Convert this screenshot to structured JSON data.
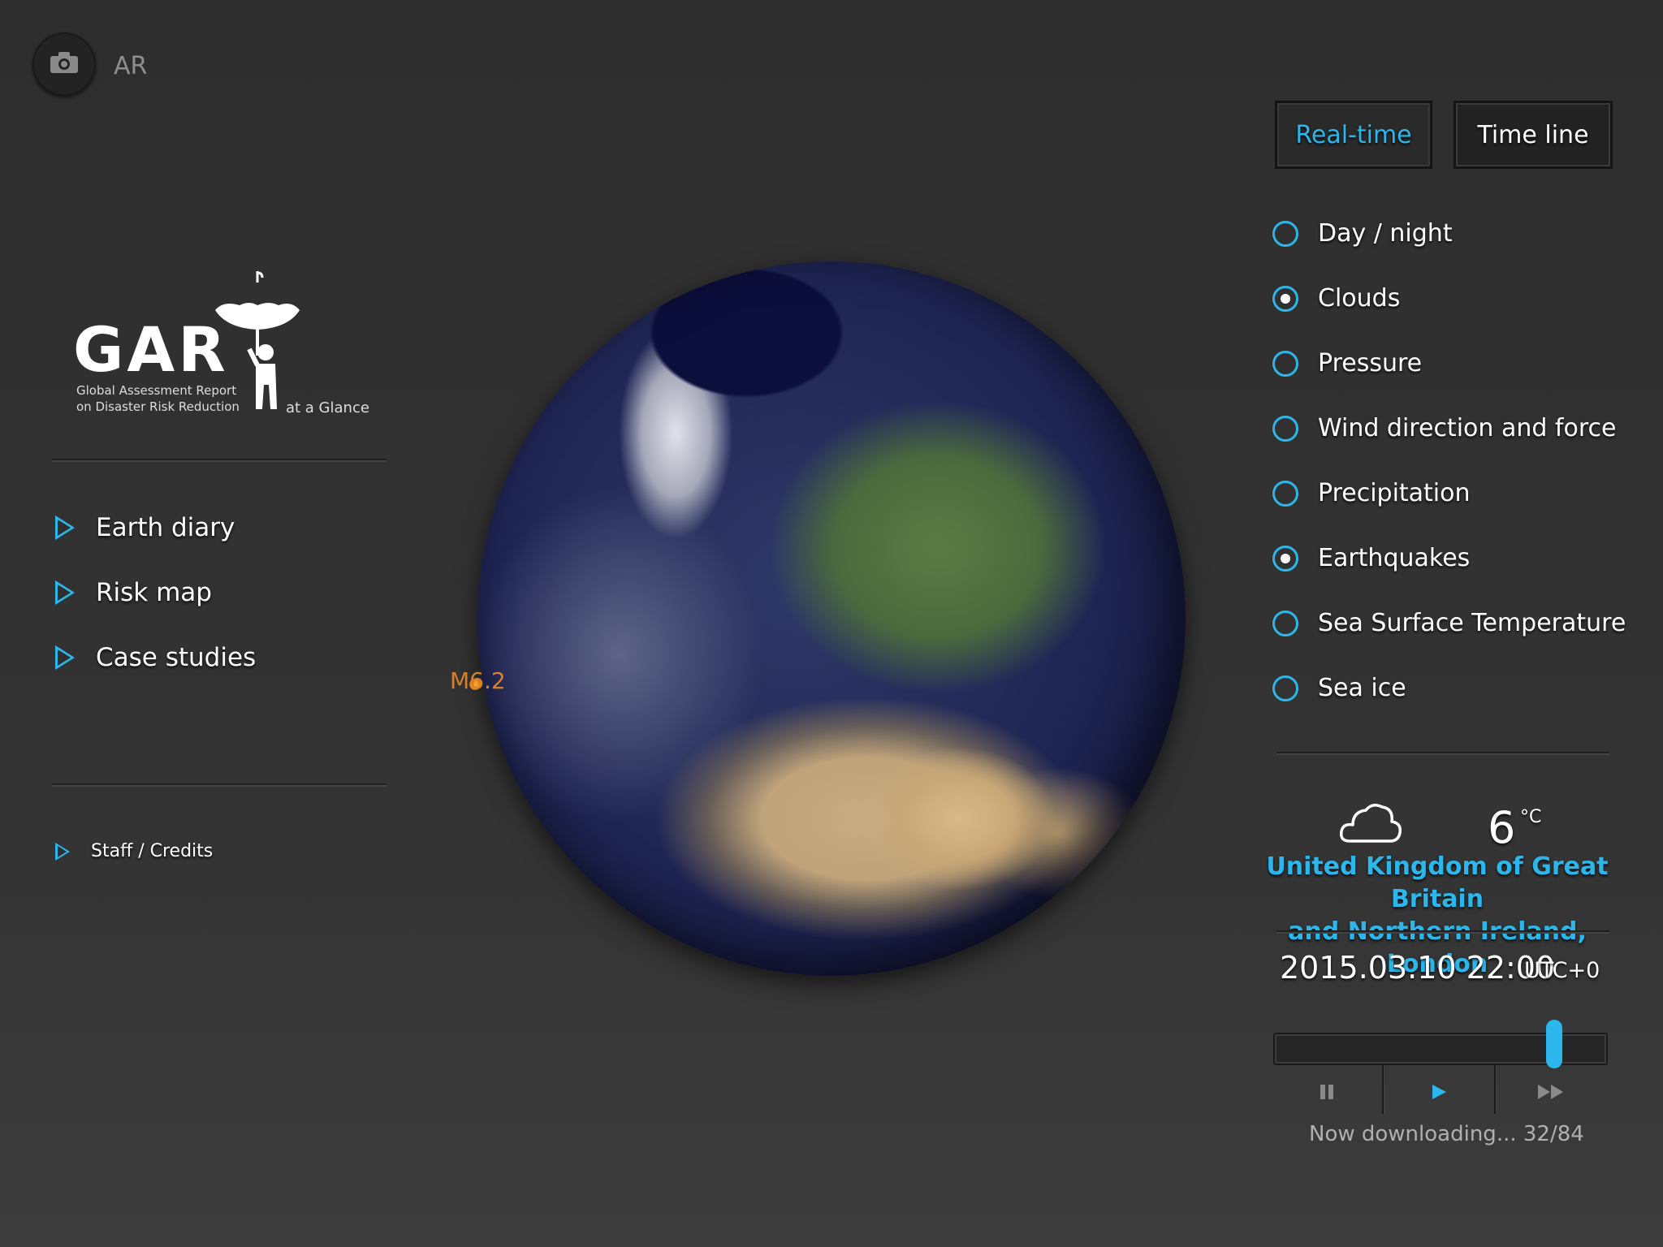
{
  "ar": {
    "label": "AR",
    "icon": "camera-icon"
  },
  "logo": {
    "letters": "GAR",
    "subtitle_1": "Global Assessment Report",
    "subtitle_2": "on Disaster Risk Reduction",
    "tagline": "at a Glance"
  },
  "nav": {
    "items": [
      {
        "label": "Earth diary"
      },
      {
        "label": "Risk map"
      },
      {
        "label": "Case studies"
      }
    ],
    "credits": "Staff / Credits"
  },
  "globe": {
    "earthquake_label": "M6.2",
    "earthquake_color": "#d9802a"
  },
  "tabs": [
    {
      "label": "Real-time",
      "active": true
    },
    {
      "label": "Time line",
      "active": false
    }
  ],
  "layers": [
    {
      "label": "Day / night",
      "selected": false
    },
    {
      "label": "Clouds",
      "selected": true
    },
    {
      "label": "Pressure",
      "selected": false
    },
    {
      "label": "Wind direction and force",
      "selected": false
    },
    {
      "label": "Precipitation",
      "selected": false
    },
    {
      "label": "Earthquakes",
      "selected": true
    },
    {
      "label": "Sea Surface Temperature",
      "selected": false
    },
    {
      "label": "Sea ice",
      "selected": false
    }
  ],
  "weather": {
    "icon": "cloud-icon",
    "temperature": "6",
    "unit": "°C",
    "location_line1": "United Kingdom of Great Britain",
    "location_line2": "and Northern Ireland, London"
  },
  "time": {
    "datetime": "2015.03.10 22:00",
    "timezone": "UTC+0",
    "position_fraction": 0.84
  },
  "playback": {
    "pause_icon": "pause-icon",
    "play_icon": "play-icon",
    "fast_forward_icon": "fast-forward-icon",
    "status": "Now downloading... 32/84"
  },
  "colors": {
    "accent": "#2bb6ec",
    "background": "#2e2e2e"
  }
}
